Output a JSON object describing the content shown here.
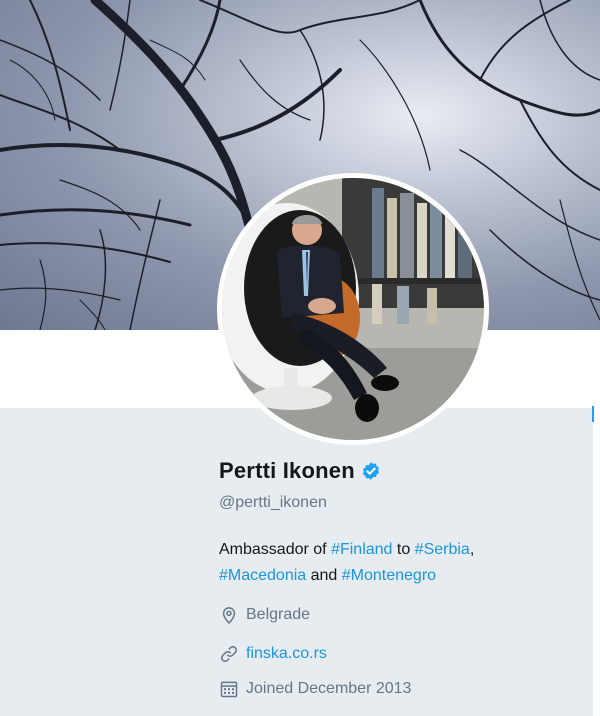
{
  "profile": {
    "name": "Pertti Ikonen",
    "handle": "@pertti_ikonen",
    "verified": true,
    "bio": {
      "t1": "Ambassador of ",
      "tag1": "#Finland",
      "t2": " to ",
      "tag2": "#Serbia",
      "t3": ",",
      "tag3": "#Macedonia",
      "t4": " and ",
      "tag4": "#Montenegro"
    },
    "location": "Belgrade",
    "website": "finska.co.rs",
    "joined": "Joined December 2013"
  },
  "colors": {
    "accent": "#1b95e0",
    "text": "#14171a",
    "muted": "#657786",
    "background": "#e6ecf0"
  },
  "icons": {
    "location": "location-pin-icon",
    "link": "link-icon",
    "calendar": "calendar-icon",
    "verified": "verified-badge-icon"
  }
}
